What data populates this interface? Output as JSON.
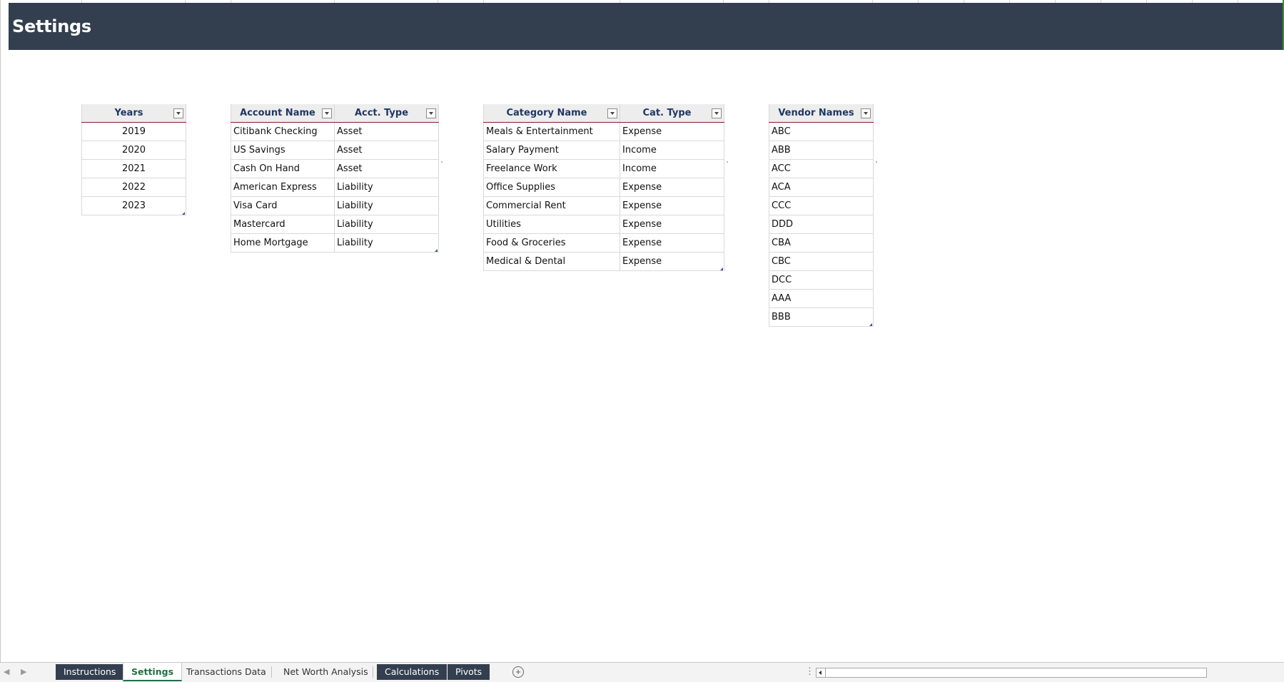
{
  "header": {
    "title": "Settings"
  },
  "tables": {
    "years": {
      "headers": [
        "Years"
      ],
      "rows": [
        [
          "2019"
        ],
        [
          "2020"
        ],
        [
          "2021"
        ],
        [
          "2022"
        ],
        [
          "2023"
        ]
      ]
    },
    "accounts": {
      "headers": [
        "Account Name",
        "Acct. Type"
      ],
      "rows": [
        [
          "Citibank Checking",
          "Asset"
        ],
        [
          "US Savings",
          "Asset"
        ],
        [
          "Cash On Hand",
          "Asset"
        ],
        [
          "American Express",
          "Liability"
        ],
        [
          "Visa Card",
          "Liability"
        ],
        [
          "Mastercard",
          "Liability"
        ],
        [
          "Home Mortgage",
          "Liability"
        ]
      ]
    },
    "categories": {
      "headers": [
        "Category Name",
        "Cat. Type"
      ],
      "rows": [
        [
          "Meals & Entertainment",
          "Expense"
        ],
        [
          "Salary Payment",
          "Income"
        ],
        [
          "Freelance Work",
          "Income"
        ],
        [
          "Office Supplies",
          "Expense"
        ],
        [
          "Commercial Rent",
          "Expense"
        ],
        [
          "Utilities",
          "Expense"
        ],
        [
          "Food & Groceries",
          "Expense"
        ],
        [
          "Medical & Dental",
          "Expense"
        ]
      ]
    },
    "vendors": {
      "headers": [
        "Vendor Names"
      ],
      "rows": [
        [
          "ABC"
        ],
        [
          "ABB"
        ],
        [
          "ACC"
        ],
        [
          "ACA"
        ],
        [
          "CCC"
        ],
        [
          "DDD"
        ],
        [
          "CBA"
        ],
        [
          "CBC"
        ],
        [
          "DCC"
        ],
        [
          "AAA"
        ],
        [
          "BBB"
        ]
      ]
    }
  },
  "stray_marks": [
    "`",
    "`",
    "`"
  ],
  "sheet_tabs": [
    {
      "label": "Instructions",
      "style": "dark"
    },
    {
      "label": "Settings",
      "style": "active"
    },
    {
      "label": "Transactions Data",
      "style": "plain"
    },
    {
      "label": "Net Worth Analysis",
      "style": "plain"
    },
    {
      "label": "Calculations",
      "style": "dark"
    },
    {
      "label": "Pivots",
      "style": "dark"
    }
  ],
  "colors": {
    "banner": "#333f4f",
    "header_text": "#1f3864",
    "active_tab": "#1e7145",
    "header_rule": "#8b1a2b"
  },
  "icons": {
    "filter": "dropdown-filter-icon",
    "add_sheet": "add-sheet-icon",
    "scroll_left": "scroll-left-icon"
  }
}
